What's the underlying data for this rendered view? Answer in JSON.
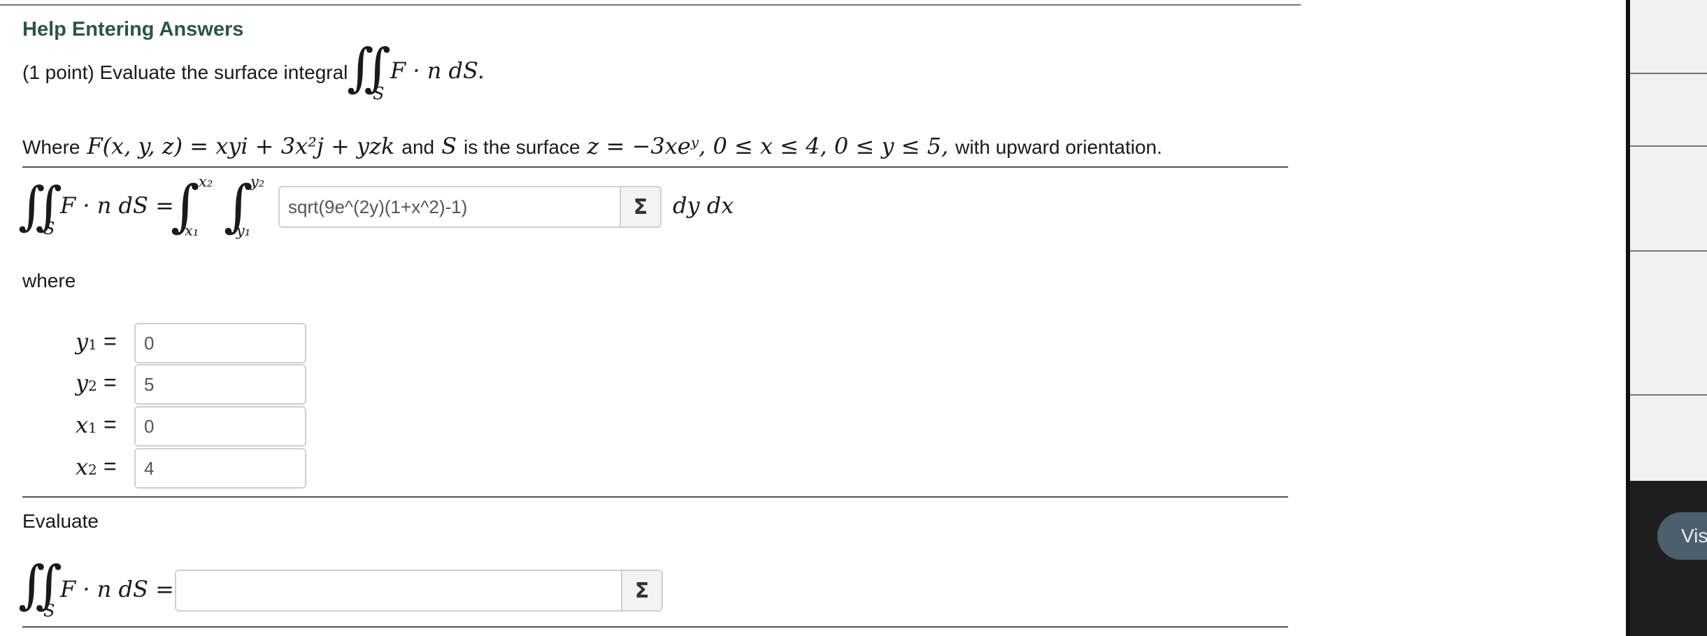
{
  "header": {
    "help_link": "Help Entering Answers"
  },
  "problem": {
    "points": "(1 point) Evaluate the surface integral",
    "integrand": "F · n dS.",
    "surface_sub": "S",
    "where_prefix": "Where",
    "field_def": "F(x, y, z) = xyi + 3x²j + yzk",
    "and_text": "and",
    "surface_var": "S",
    "is_surface": "is the surface",
    "surface_eq": "z = −3xeʸ, 0 ≤ x ≤ 4,  0 ≤ y ≤ 5,",
    "orientation": "with upward orientation."
  },
  "setup": {
    "lhs": "F · n dS =",
    "lim_x_top": "x₂",
    "lim_x_bottom": "x₁",
    "lim_y_top": "y₂",
    "lim_y_bottom": "y₁",
    "integrand_value": "sqrt(9e^(2y)(1+x^2)-1)",
    "differentials": "dy dx",
    "where_label": "where"
  },
  "limits": [
    {
      "label": "y",
      "sub": "1",
      "value": "0"
    },
    {
      "label": "y",
      "sub": "2",
      "value": "5"
    },
    {
      "label": "x",
      "sub": "1",
      "value": "0"
    },
    {
      "label": "x",
      "sub": "2",
      "value": "4"
    }
  ],
  "evaluate": {
    "label": "Evaluate",
    "lhs": "F · n dS =",
    "value": ""
  },
  "icons": {
    "sigma": "Σ",
    "equals": "="
  },
  "sidebar": {
    "visible_button": "Vis"
  }
}
